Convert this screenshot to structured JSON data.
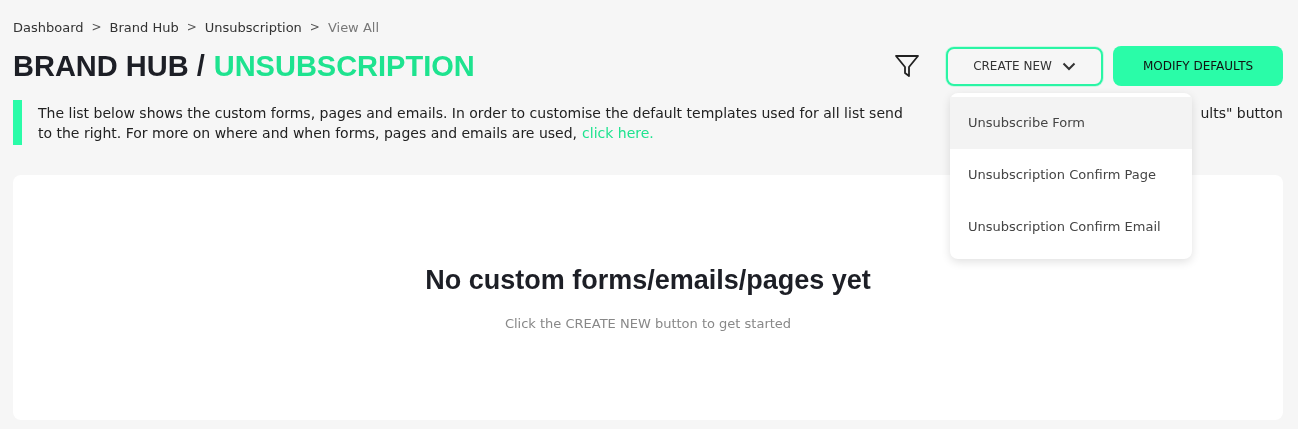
{
  "breadcrumb": [
    {
      "label": "Dashboard",
      "current": false
    },
    {
      "label": "Brand Hub",
      "current": false
    },
    {
      "label": "Unsubscription",
      "current": false
    },
    {
      "label": "View All",
      "current": true
    }
  ],
  "breadcrumb_separator": ">",
  "title": {
    "prefix": "BRAND HUB /",
    "highlight": "UNSUBSCRIPTION"
  },
  "toolbar": {
    "create_new": {
      "label": "CREATE NEW",
      "expanded": true
    },
    "modify_defaults": {
      "label": "MODIFY DEFAULTS"
    }
  },
  "dropdown": [
    {
      "label": "Unsubscribe Form",
      "selected": true
    },
    {
      "label": "Unsubscription Confirm Page",
      "selected": false
    },
    {
      "label": "Unsubscription Confirm Email",
      "selected": false
    }
  ],
  "notice": {
    "line_1_start": "The list below shows the custom forms, pages and emails. In order to customise the default templates used for all list send",
    "line_1_end": "ults\" button",
    "line_2": "to the right. For more on where and when forms, pages and emails are used,",
    "link": "click here."
  },
  "empty_state": {
    "heading": "No custom forms/emails/pages yet",
    "hint": "Click the CREATE NEW button to get started"
  }
}
